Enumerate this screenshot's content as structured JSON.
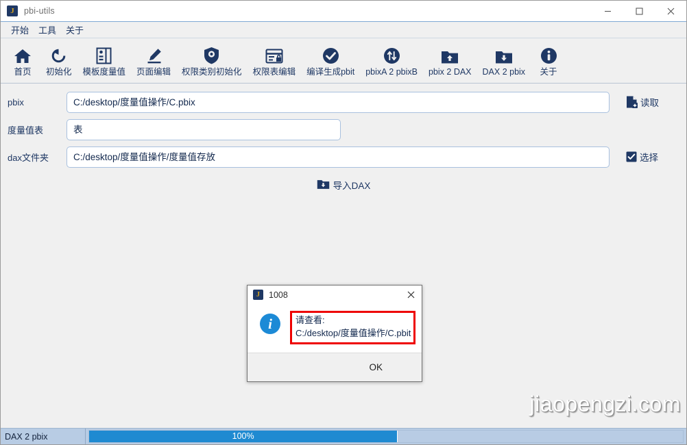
{
  "window": {
    "title": "pbi-utils",
    "app_icon_letter": "J",
    "controls": {
      "minimize": "minimize-icon",
      "maximize": "maximize-icon",
      "close": "close-icon"
    }
  },
  "menubar": {
    "items": [
      {
        "label": "开始"
      },
      {
        "label": "工具"
      },
      {
        "label": "关于"
      }
    ]
  },
  "toolbar": {
    "items": [
      {
        "label": "首页",
        "icon": "home-icon"
      },
      {
        "label": "初始化",
        "icon": "refresh-icon"
      },
      {
        "label": "模板度量值",
        "icon": "template-icon"
      },
      {
        "label": "页面编辑",
        "icon": "pencil-icon"
      },
      {
        "label": "权限类别初始化",
        "icon": "shield-icon"
      },
      {
        "label": "权限表编辑",
        "icon": "table-lock-icon"
      },
      {
        "label": "编译生成pbit",
        "icon": "check-circle-icon"
      },
      {
        "label": "pbixA 2 pbixB",
        "icon": "swap-circle-icon"
      },
      {
        "label": "pbix 2 DAX",
        "icon": "folder-up-icon"
      },
      {
        "label": "DAX 2 pbix",
        "icon": "folder-down-icon"
      },
      {
        "label": "关于",
        "icon": "info-circle-icon"
      }
    ]
  },
  "form": {
    "rows": [
      {
        "label": "pbix",
        "value": "C:/desktop/度量值操作/C.pbix",
        "placeholder": ""
      },
      {
        "label": "度量值表",
        "value": "表",
        "placeholder": ""
      },
      {
        "label": "dax文件夹",
        "value": "C:/desktop/度量值操作/度量值存放",
        "placeholder": ""
      }
    ],
    "read_button": {
      "label": "读取",
      "icon": "file-add-icon"
    },
    "select_button": {
      "label": "选择",
      "icon": "checkbox-checked-icon"
    },
    "import_button": {
      "label": "导入DAX",
      "icon": "folder-down-icon"
    }
  },
  "dialog": {
    "title": "1008",
    "icon_letter": "J",
    "close_icon": "close-icon",
    "info_icon": "info-icon",
    "message_line1": "请查看:",
    "message_line2": "C:/desktop/度量值操作/C.pbit",
    "ok_label": "OK",
    "highlight_color": "#ee0000"
  },
  "statusbar": {
    "task_label": "DAX 2 pbix",
    "progress_text": "100%",
    "progress_percent": 100,
    "progress_color": "#1f8ad1"
  },
  "watermark": {
    "text": "jiaopengzi.com"
  }
}
